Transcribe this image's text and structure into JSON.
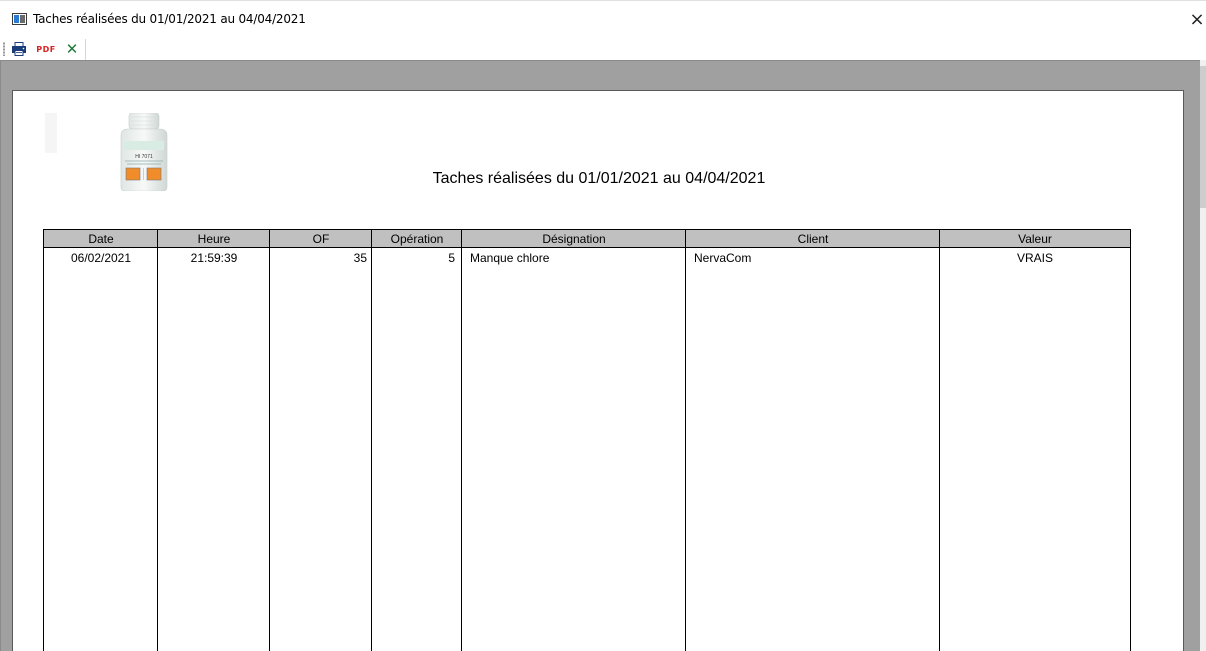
{
  "window": {
    "title": "Taches réalisées du 01/01/2021 au 04/04/2021",
    "close_label": "×"
  },
  "toolbar": {
    "print_icon": "printer-icon",
    "pdf_label": "PDF",
    "excel_label": "✕"
  },
  "report": {
    "title": "Taches réalisées du 01/01/2021 au 04/04/2021",
    "logo": "product-bottle-logo",
    "logo_text": "HI 7071"
  },
  "table": {
    "headers": [
      "Date",
      "Heure",
      "OF",
      "Opération",
      "Désignation",
      "Client",
      "Valeur"
    ],
    "rows": [
      [
        "06/02/2021",
        "21:59:39",
        "35",
        "5",
        "Manque chlore",
        "NervaCom",
        "VRAIS"
      ]
    ]
  },
  "colors": {
    "preview_background": "#a0a0a0",
    "header_fill": "#c0c0c0",
    "pdf_red": "#d92121",
    "excel_green": "#1f7a3c"
  }
}
